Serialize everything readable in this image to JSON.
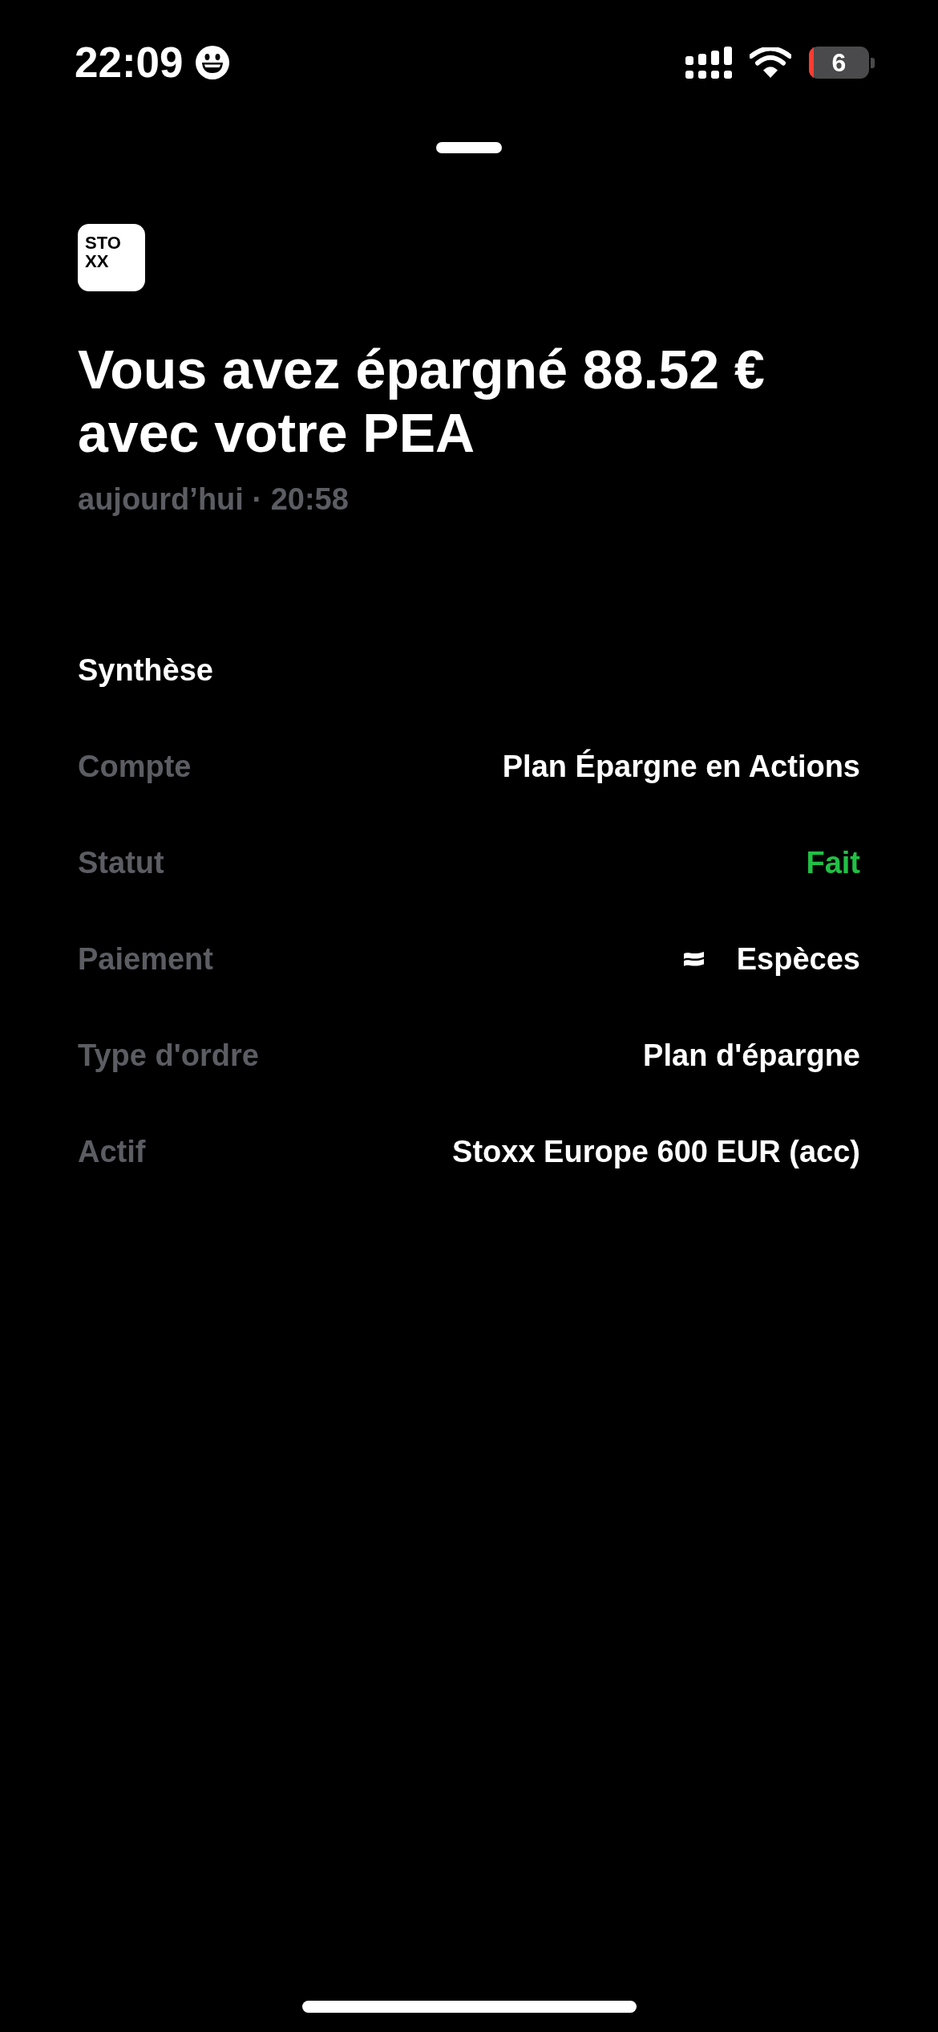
{
  "status_bar": {
    "time": "22:09",
    "battery": "6"
  },
  "sheet": {
    "logo": {
      "lines": [
        "STO",
        "XX"
      ]
    },
    "title": "Vous avez épargné 88.52 € avec votre PEA",
    "subtitle": "aujourd’hui · 20:58"
  },
  "summary": {
    "heading": "Synthèse",
    "rows": [
      {
        "kind": "text",
        "label": "Compte",
        "value": "Plan Épargne en Actions"
      },
      {
        "kind": "status",
        "label": "Statut",
        "value": "Fait",
        "color": "#21c045"
      },
      {
        "kind": "payment",
        "label": "Paiement",
        "value": "Espèces"
      },
      {
        "kind": "text",
        "label": "Type d'ordre",
        "value": "Plan d'épargne"
      },
      {
        "kind": "text",
        "label": "Actif",
        "value": "Stoxx Europe 600 EUR (acc)"
      }
    ]
  }
}
